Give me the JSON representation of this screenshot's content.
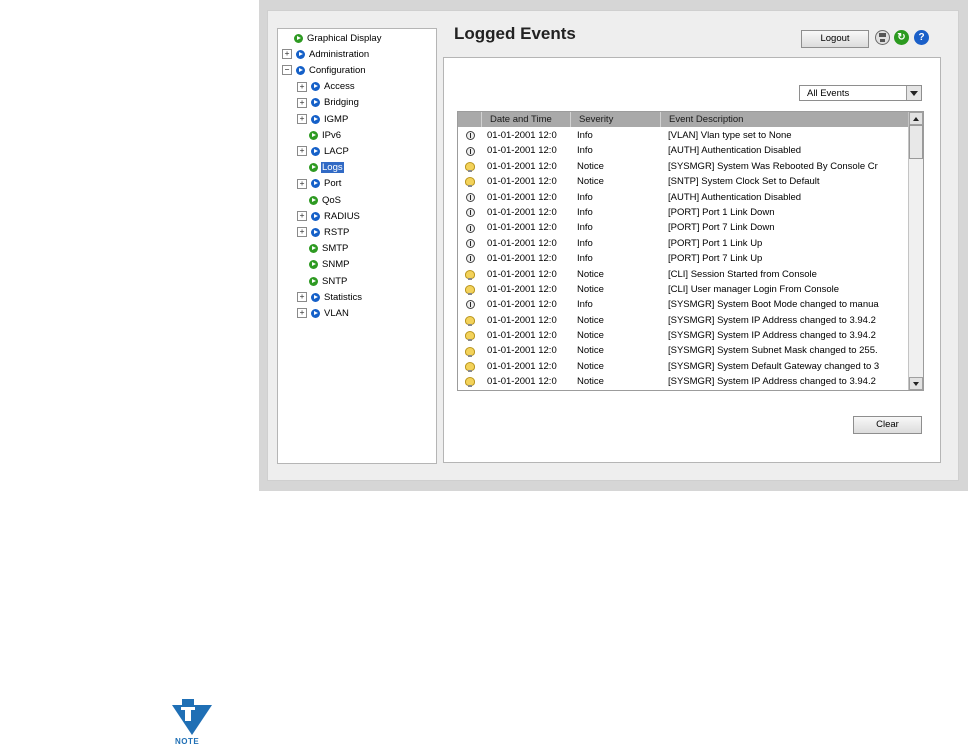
{
  "page": {
    "title": "Logged Events"
  },
  "header": {
    "logout_label": "Logout",
    "icons": [
      "save-icon",
      "refresh-icon",
      "help-icon"
    ]
  },
  "nav": {
    "items": [
      {
        "label": "Graphical Display",
        "icon": "green",
        "expander": ""
      },
      {
        "label": "Administration",
        "icon": "blue",
        "expander": "+"
      },
      {
        "label": "Configuration",
        "icon": "blue",
        "expander": "−"
      },
      {
        "label": "Access",
        "icon": "blue",
        "expander": "+"
      },
      {
        "label": "Bridging",
        "icon": "blue",
        "expander": "+"
      },
      {
        "label": "IGMP",
        "icon": "blue",
        "expander": "+"
      },
      {
        "label": "IPv6",
        "icon": "green",
        "expander": ""
      },
      {
        "label": "LACP",
        "icon": "blue",
        "expander": "+"
      },
      {
        "label": "Logs",
        "icon": "green",
        "expander": "",
        "selected": true
      },
      {
        "label": "Port",
        "icon": "blue",
        "expander": "+"
      },
      {
        "label": "QoS",
        "icon": "green",
        "expander": ""
      },
      {
        "label": "RADIUS",
        "icon": "blue",
        "expander": "+"
      },
      {
        "label": "RSTP",
        "icon": "blue",
        "expander": "+"
      },
      {
        "label": "SMTP",
        "icon": "green",
        "expander": ""
      },
      {
        "label": "SNMP",
        "icon": "green",
        "expander": ""
      },
      {
        "label": "SNTP",
        "icon": "green",
        "expander": ""
      },
      {
        "label": "Statistics",
        "icon": "blue",
        "expander": "+"
      },
      {
        "label": "VLAN",
        "icon": "blue",
        "expander": "+"
      }
    ]
  },
  "filter": {
    "selected": "All Events"
  },
  "table": {
    "columns": [
      "",
      "Date and Time",
      "Severity",
      "Event Description"
    ],
    "rows": [
      {
        "icon": "info",
        "date": "01-01-2001 12:0",
        "severity": "Info",
        "description": "[VLAN] Vlan type set to None"
      },
      {
        "icon": "info",
        "date": "01-01-2001 12:0",
        "severity": "Info",
        "description": "[AUTH] Authentication Disabled"
      },
      {
        "icon": "notice",
        "date": "01-01-2001 12:0",
        "severity": "Notice",
        "description": "[SYSMGR] System Was Rebooted By Console Cr"
      },
      {
        "icon": "notice",
        "date": "01-01-2001 12:0",
        "severity": "Notice",
        "description": "[SNTP] System Clock Set to Default"
      },
      {
        "icon": "info",
        "date": "01-01-2001 12:0",
        "severity": "Info",
        "description": "[AUTH] Authentication Disabled"
      },
      {
        "icon": "info",
        "date": "01-01-2001 12:0",
        "severity": "Info",
        "description": "[PORT] Port 1 Link Down"
      },
      {
        "icon": "info",
        "date": "01-01-2001 12:0",
        "severity": "Info",
        "description": "[PORT] Port 7 Link Down"
      },
      {
        "icon": "info",
        "date": "01-01-2001 12:0",
        "severity": "Info",
        "description": "[PORT] Port 1 Link Up"
      },
      {
        "icon": "info",
        "date": "01-01-2001 12:0",
        "severity": "Info",
        "description": "[PORT] Port 7 Link Up"
      },
      {
        "icon": "notice",
        "date": "01-01-2001 12:0",
        "severity": "Notice",
        "description": "[CLI] Session Started from Console"
      },
      {
        "icon": "notice",
        "date": "01-01-2001 12:0",
        "severity": "Notice",
        "description": "[CLI] User manager Login From Console"
      },
      {
        "icon": "info",
        "date": "01-01-2001 12:0",
        "severity": "Info",
        "description": "[SYSMGR] System Boot Mode changed to manua"
      },
      {
        "icon": "notice",
        "date": "01-01-2001 12:0",
        "severity": "Notice",
        "description": "[SYSMGR] System IP Address changed to 3.94.2"
      },
      {
        "icon": "notice",
        "date": "01-01-2001 12:0",
        "severity": "Notice",
        "description": "[SYSMGR] System IP Address changed to 3.94.2"
      },
      {
        "icon": "notice",
        "date": "01-01-2001 12:0",
        "severity": "Notice",
        "description": "[SYSMGR] System Subnet Mask changed to 255."
      },
      {
        "icon": "notice",
        "date": "01-01-2001 12:0",
        "severity": "Notice",
        "description": "[SYSMGR] System Default Gateway changed to 3"
      },
      {
        "icon": "notice",
        "date": "01-01-2001 12:0",
        "severity": "Notice",
        "description": "[SYSMGR] System IP Address changed to 3.94.2"
      }
    ]
  },
  "actions": {
    "clear_label": "Clear"
  },
  "note": {
    "label": "NOTE"
  },
  "colors": {
    "selected_bg": "#316ac5",
    "header_bg": "#a9a9a9",
    "green_icon": "#2e9a22",
    "blue_icon": "#1560c8"
  }
}
